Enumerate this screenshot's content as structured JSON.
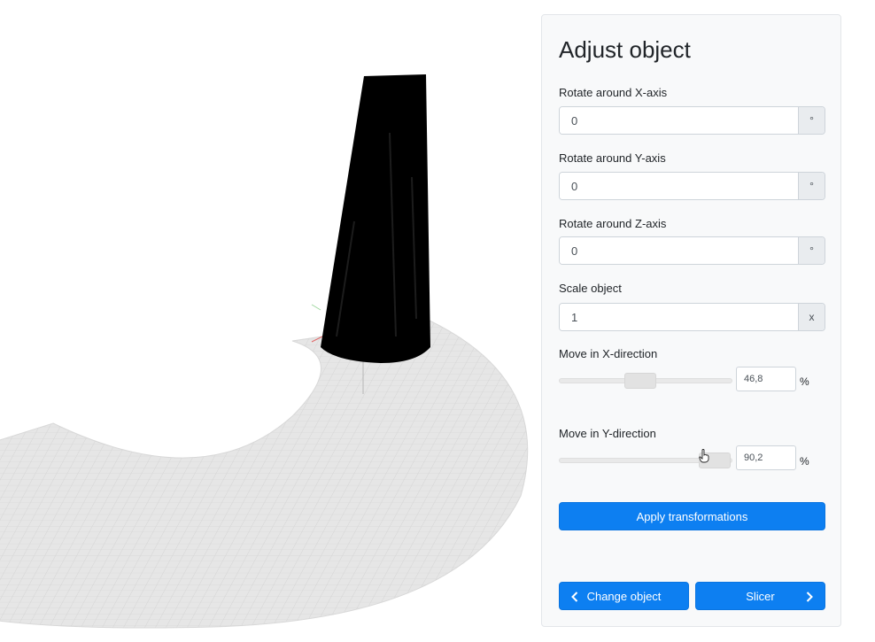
{
  "panel": {
    "title": "Adjust object",
    "rotate_x": {
      "label": "Rotate around X-axis",
      "value": "0",
      "unit": "°"
    },
    "rotate_y": {
      "label": "Rotate around Y-axis",
      "value": "0",
      "unit": "°"
    },
    "rotate_z": {
      "label": "Rotate around Z-axis",
      "value": "0",
      "unit": "°"
    },
    "scale": {
      "label": "Scale object",
      "value": "1",
      "unit": "x"
    },
    "move_x": {
      "label": "Move in X-direction",
      "value": "46,8",
      "unit": "%",
      "level": 46.8
    },
    "move_y": {
      "label": "Move in Y-direction",
      "value": "90,2",
      "unit": "%",
      "level": 90.2
    },
    "apply_label": "Apply transformations",
    "change_object_label": "Change object",
    "slicer_label": "Slicer"
  },
  "colors": {
    "accent": "#0d7ff1",
    "panel_bg": "#f8f9fa",
    "object": "#000000",
    "build_plate": "#e6e6e6",
    "grid_line": "#cfcfcf"
  },
  "icons": [
    "chevron-left-icon",
    "chevron-right-icon",
    "hand-pointer-icon"
  ]
}
